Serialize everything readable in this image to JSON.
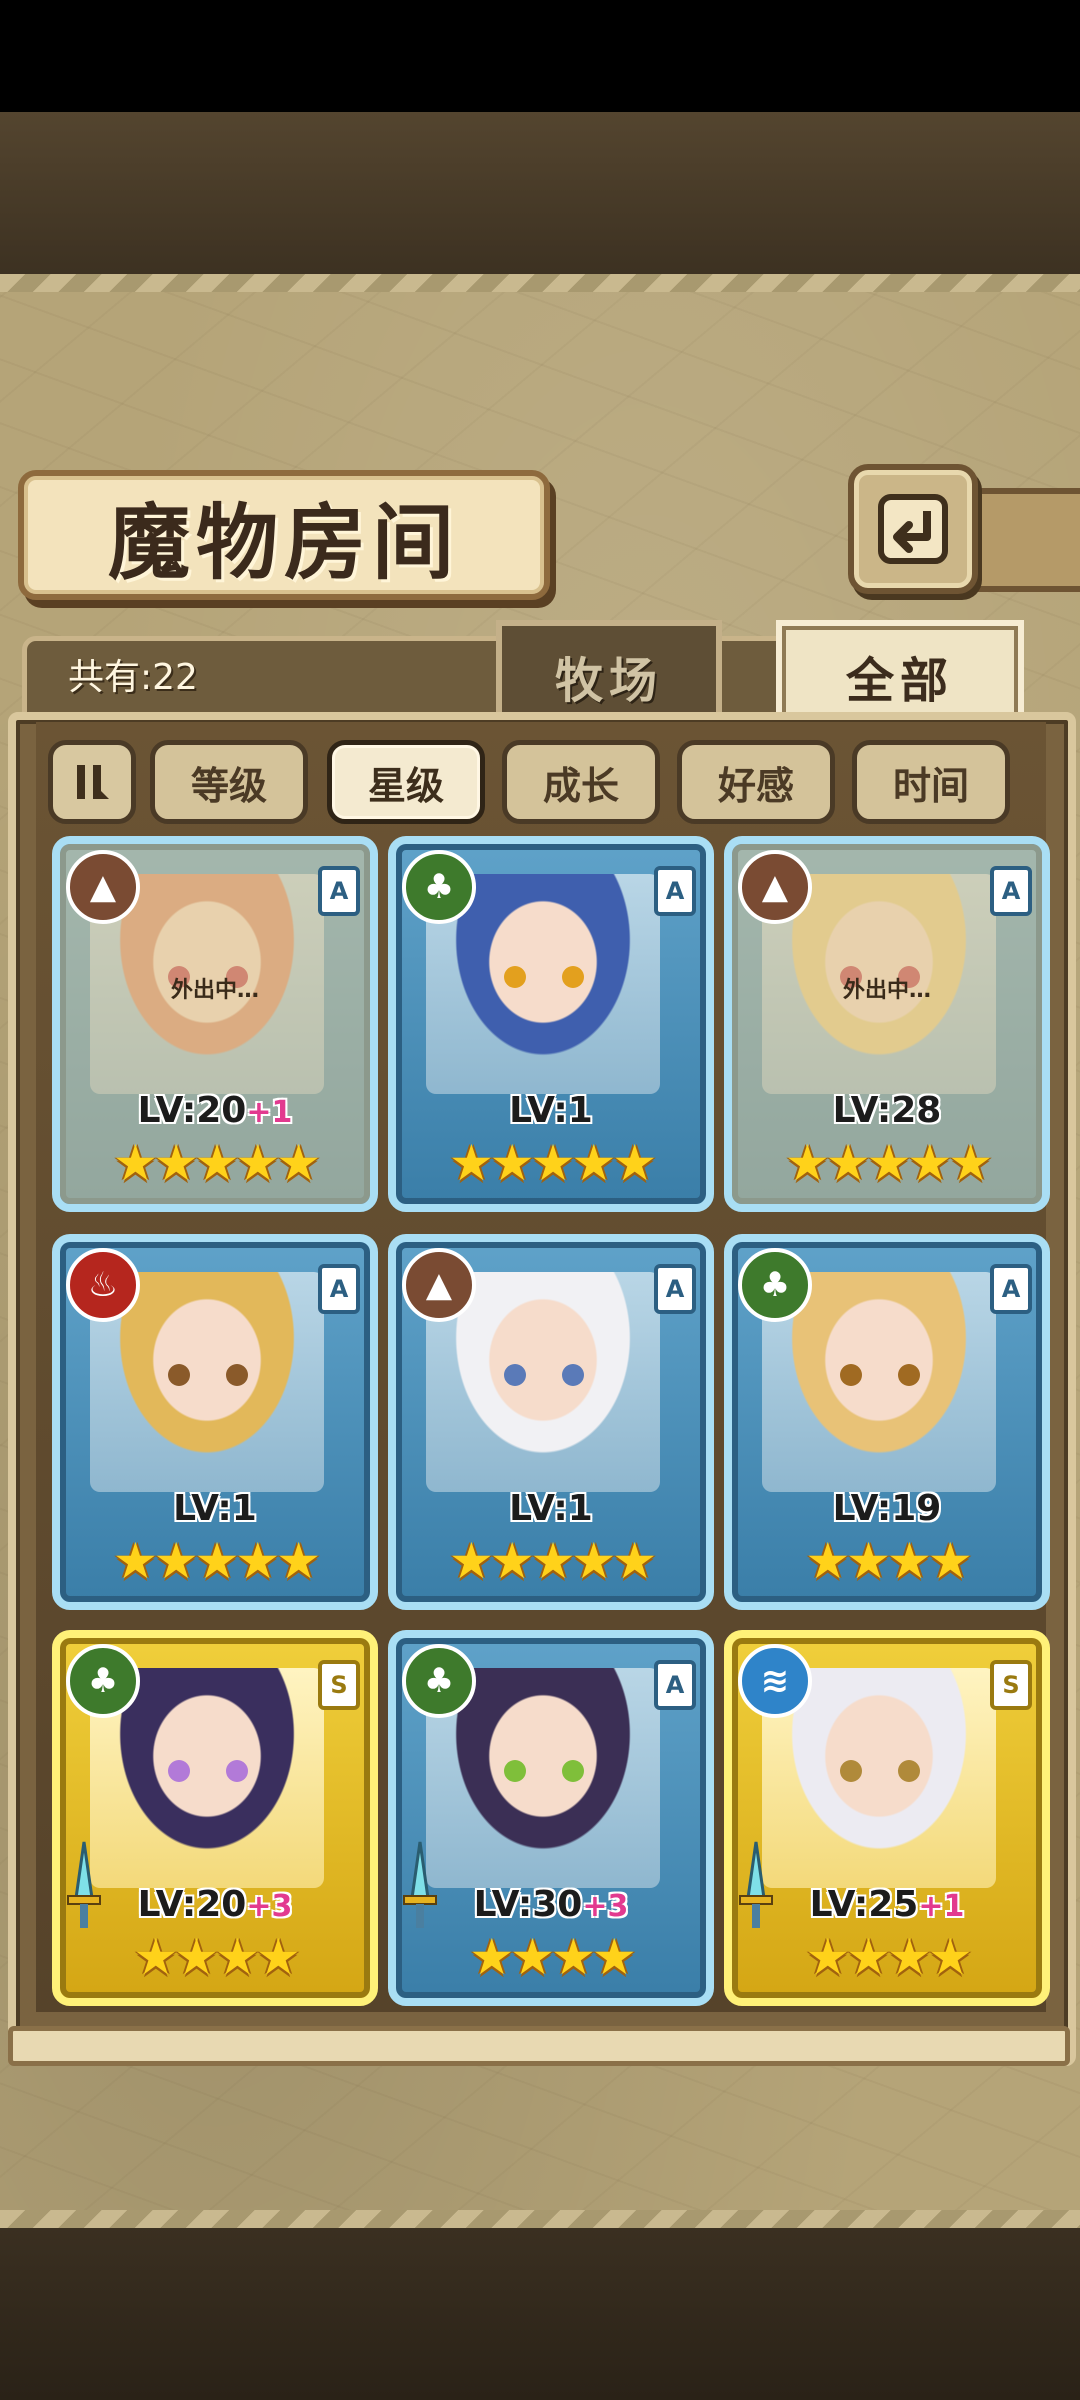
{
  "header": {
    "title": "魔物房间"
  },
  "count_label": "共有:22",
  "tabs": [
    {
      "label": "牧场"
    },
    {
      "label": "全部"
    }
  ],
  "filters": [
    {
      "label": "等级"
    },
    {
      "label": "星级"
    },
    {
      "label": "成长"
    },
    {
      "label": "好感"
    },
    {
      "label": "时间"
    }
  ],
  "active_filter": "星级",
  "cards": [
    {
      "element": "earth",
      "rank": "A",
      "level": "LV:20",
      "bonus": "+1",
      "stars": 5,
      "away": "外出中…",
      "hair": "#d98a6a",
      "eye": "#c0394a"
    },
    {
      "element": "grass",
      "rank": "A",
      "level": "LV:1",
      "bonus": "",
      "stars": 5,
      "away": "",
      "hair": "#3f5fae",
      "eye": "#e3a01e"
    },
    {
      "element": "earth",
      "rank": "A",
      "level": "LV:28",
      "bonus": "",
      "stars": 5,
      "away": "外出中…",
      "hair": "#e8cf86",
      "eye": "#c0394a"
    },
    {
      "element": "fire",
      "rank": "A",
      "level": "LV:1",
      "bonus": "",
      "stars": 5,
      "away": "",
      "hair": "#e2b85a",
      "eye": "#8a5a2a"
    },
    {
      "element": "earth",
      "rank": "A",
      "level": "LV:1",
      "bonus": "",
      "stars": 5,
      "away": "",
      "hair": "#f1f1f4",
      "eye": "#5a7ab8"
    },
    {
      "element": "grass",
      "rank": "A",
      "level": "LV:19",
      "bonus": "",
      "stars": 4,
      "away": "",
      "hair": "#e8c277",
      "eye": "#a06a22"
    },
    {
      "element": "grass",
      "rank": "S",
      "level": "LV:20",
      "bonus": "+3",
      "stars": 4,
      "away": "",
      "hair": "#3a2f5e",
      "eye": "#b27ad8"
    },
    {
      "element": "grass",
      "rank": "A",
      "level": "LV:30",
      "bonus": "+3",
      "stars": 4,
      "away": "",
      "hair": "#3b2f55",
      "eye": "#7fbf3a"
    },
    {
      "element": "water",
      "rank": "S",
      "level": "LV:25",
      "bonus": "+1",
      "stars": 4,
      "away": "",
      "hair": "#ecebf2",
      "eye": "#b08a3a"
    }
  ]
}
